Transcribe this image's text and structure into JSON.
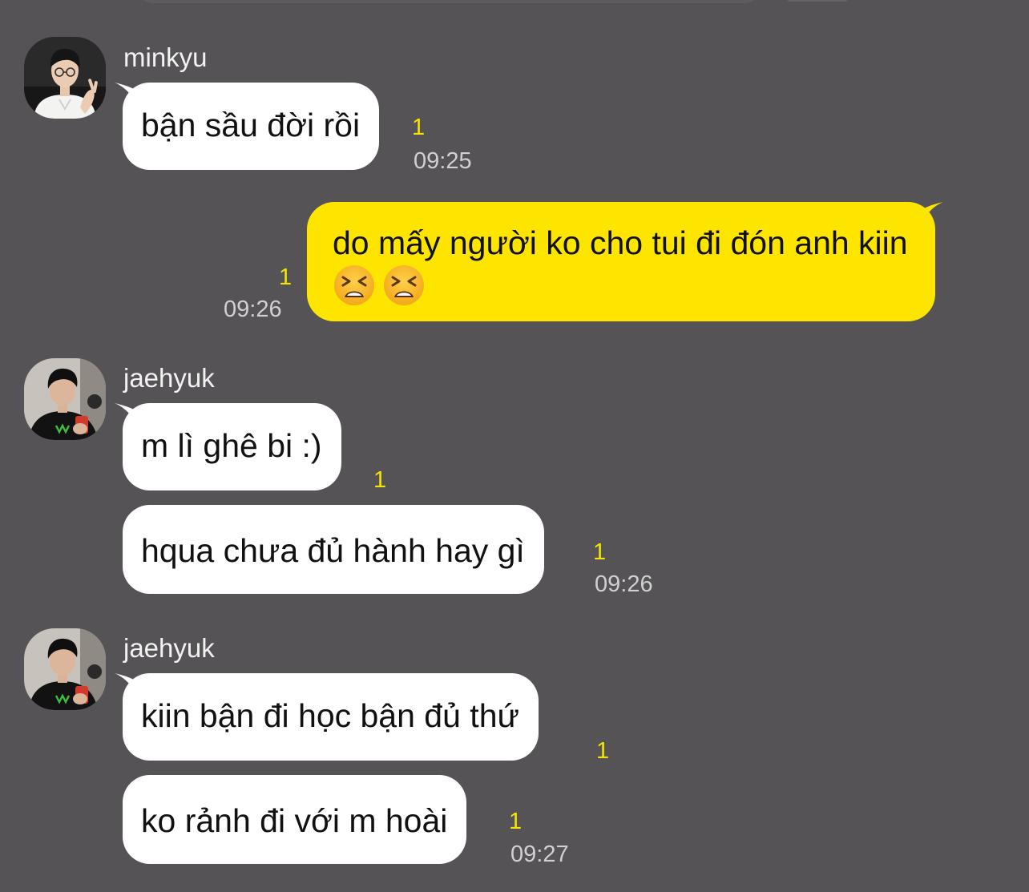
{
  "chat": {
    "messages": [
      {
        "sender": "minkyu",
        "avatar_icon": "profile-photo-minkyu",
        "bubbles": [
          {
            "text": "bận sầu đời rồi",
            "unread": "1",
            "time": "09:25"
          }
        ]
      },
      {
        "sender": "me",
        "outgoing": true,
        "bubbles": [
          {
            "line1": "do mấy người ko cho tui đi đón anh kiin",
            "emoji": [
              "tired-face-emoji",
              "tired-face-emoji"
            ],
            "unread": "1",
            "time": "09:26"
          }
        ]
      },
      {
        "sender": "jaehyuk",
        "avatar_icon": "profile-photo-jaehyuk",
        "bubbles": [
          {
            "text": "m lì ghê bi :)",
            "unread": "1"
          },
          {
            "text": "hqua chưa đủ hành hay gì",
            "unread": "1",
            "time": "09:26"
          }
        ]
      },
      {
        "sender": "jaehyuk",
        "avatar_icon": "profile-photo-jaehyuk",
        "bubbles": [
          {
            "text": "kiin bận đi học bận đủ thứ",
            "unread": "1"
          },
          {
            "text": "ko rảnh đi với m hoài",
            "unread": "1",
            "time": "09:27"
          }
        ]
      }
    ]
  },
  "colors": {
    "background": "#555355",
    "received_bubble": "#ffffff",
    "sent_bubble": "#fee500",
    "unread_count": "#f5e400",
    "timestamp": "#d0d0d0"
  }
}
